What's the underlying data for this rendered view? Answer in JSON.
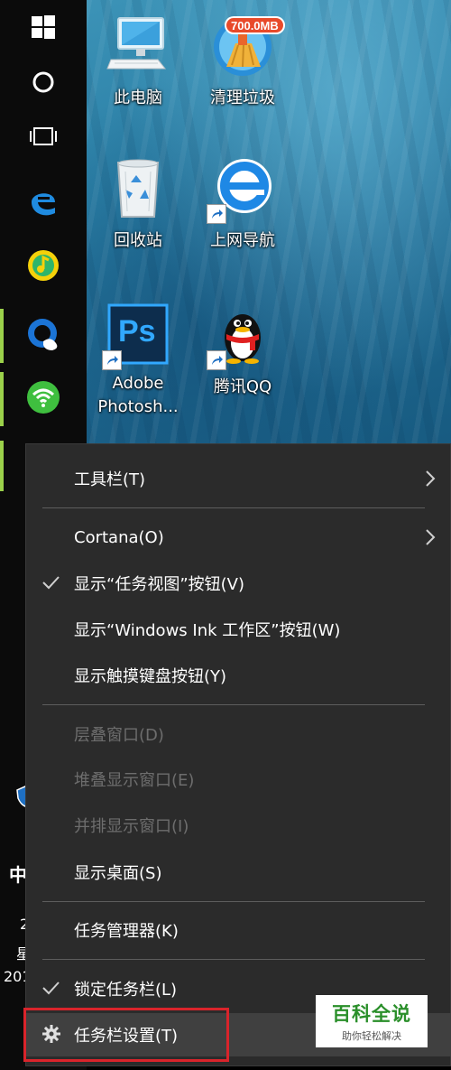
{
  "colors": {
    "accent_green": "#9bd14a",
    "menu_bg": "#2b2b2b",
    "menu_text": "#ffffff",
    "menu_text_disabled": "#6d6d6d",
    "highlight_box": "#d9242b",
    "watermark_green": "#2a8f2a"
  },
  "taskbar": {
    "buttons": [
      {
        "name": "start",
        "icon": "windows-logo-icon"
      },
      {
        "name": "cortana",
        "icon": "cortana-circle-icon"
      },
      {
        "name": "task-view",
        "icon": "task-view-icon"
      },
      {
        "name": "edge",
        "icon": "edge-icon"
      },
      {
        "name": "music",
        "icon": "qq-music-icon"
      },
      {
        "name": "browser",
        "icon": "browser-icon"
      },
      {
        "name": "wifi",
        "icon": "wifi-icon"
      }
    ],
    "clock_partial": {
      "line1": "中",
      "line2": "2",
      "line3": "星",
      "line4": "201"
    }
  },
  "desktop": {
    "icons": [
      {
        "label": "此电脑",
        "icon": "computer-icon"
      },
      {
        "label": "清理垃圾",
        "icon": "cleanup-broom-icon",
        "badge": "700.0MB"
      },
      {
        "label": "回收站",
        "icon": "recycle-bin-icon"
      },
      {
        "label": "上网导航",
        "icon": "ie-icon"
      },
      {
        "label": "Adobe Photosh...",
        "label_line1": "Adobe",
        "label_line2": "Photosh...",
        "icon": "photoshop-icon",
        "ps_text": "Ps"
      },
      {
        "label": "腾讯QQ",
        "icon": "qq-penguin-icon"
      }
    ]
  },
  "context_menu": {
    "items": [
      {
        "label": "工具栏(T)",
        "submenu": true,
        "enabled": true
      },
      {
        "label": "Cortana(O)",
        "submenu": true,
        "enabled": true
      },
      {
        "label": "显示“任务视图”按钮(V)",
        "checked": true,
        "enabled": true
      },
      {
        "label": "显示“Windows Ink 工作区”按钮(W)",
        "enabled": true
      },
      {
        "label": "显示触摸键盘按钮(Y)",
        "enabled": true
      },
      {
        "label": "层叠窗口(D)",
        "enabled": false
      },
      {
        "label": "堆叠显示窗口(E)",
        "enabled": false
      },
      {
        "label": "并排显示窗口(I)",
        "enabled": false
      },
      {
        "label": "显示桌面(S)",
        "enabled": true
      },
      {
        "label": "任务管理器(K)",
        "enabled": true
      },
      {
        "label": "锁定任务栏(L)",
        "checked": true,
        "enabled": true
      },
      {
        "label": "任务栏设置(T)",
        "icon": "gear-icon",
        "enabled": true,
        "highlighted": true
      }
    ]
  },
  "watermark": {
    "title": "百科全说",
    "subtitle": "助你轻松解决"
  }
}
